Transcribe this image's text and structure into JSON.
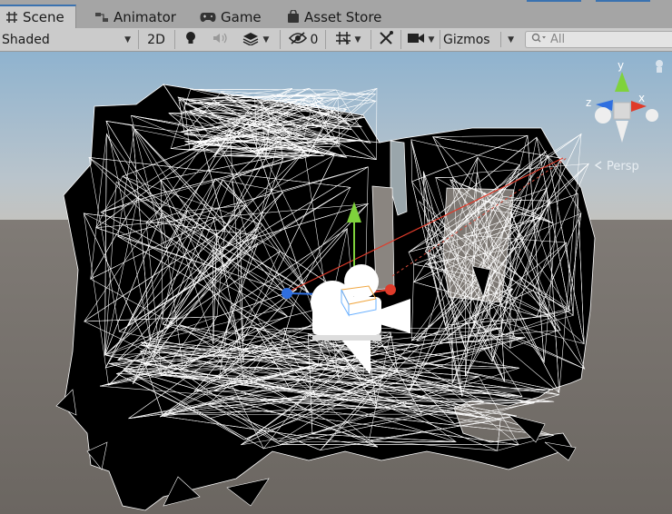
{
  "tabs": [
    {
      "label": "Scene",
      "icon": "scene-hash-icon",
      "active": true
    },
    {
      "label": "Animator",
      "icon": "animator-icon",
      "active": false
    },
    {
      "label": "Game",
      "icon": "gamepad-icon",
      "active": false
    },
    {
      "label": "Asset Store",
      "icon": "shopping-bag-icon",
      "active": false
    }
  ],
  "toolbar": {
    "draw_mode": "Shaded",
    "mode_2d": "2D",
    "hidden_count": "0",
    "gizmos_label": "Gizmos",
    "search_placeholder": "All"
  },
  "gizmo": {
    "y_label": "y",
    "x_label": "x",
    "z_label": "z",
    "projection_label": "Persp"
  },
  "colors": {
    "tab_bg": "#a5a5a5",
    "toolbar_bg": "#cbcbcb",
    "sky": "#a3bccf",
    "ground": "#6f6a66",
    "mesh_fill": "#000000",
    "wire": "#ffffff",
    "x_axis": "#e03b2a",
    "y_axis": "#7fd23c",
    "z_axis": "#2f6fe0",
    "active_tab_accent": "#3a72b0"
  }
}
